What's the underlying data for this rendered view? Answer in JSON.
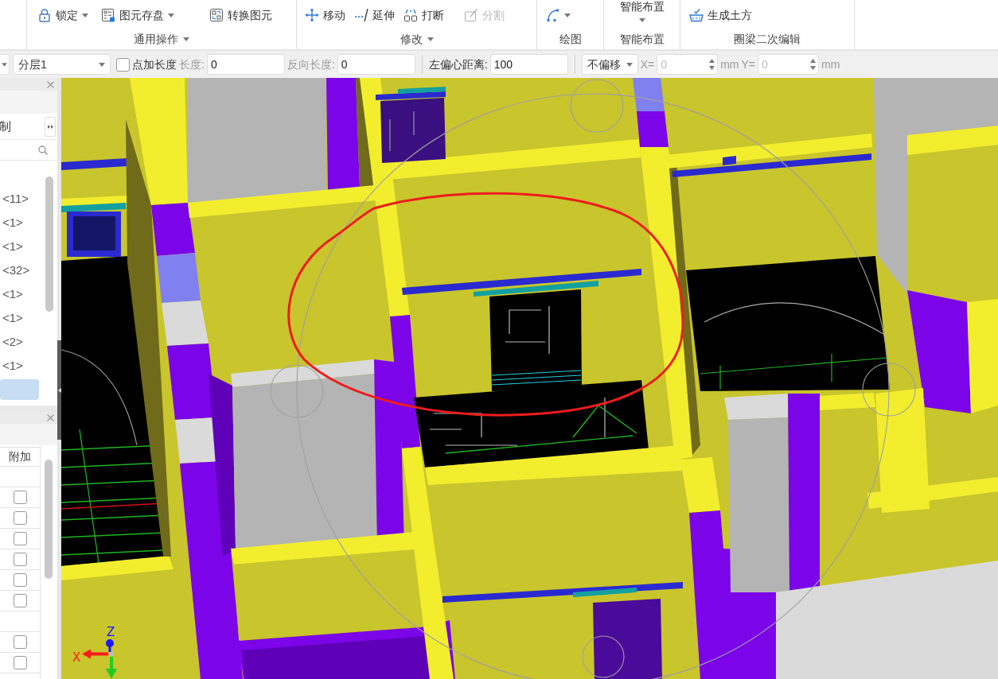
{
  "ribbon": {
    "groups": [
      {
        "label": "通用操作",
        "menu": true,
        "buttons": [
          {
            "label": "锁定",
            "kind": "small",
            "dropdown": true,
            "disabled": false
          },
          {
            "label": "图元存盘",
            "kind": "small",
            "dropdown": true,
            "disabled": false
          },
          {
            "label": "转换图元",
            "kind": "small",
            "dropdown": false,
            "disabled": false
          }
        ]
      },
      {
        "label": "修改",
        "menu": true,
        "buttons": [
          {
            "label": "移动",
            "kind": "small",
            "dropdown": false,
            "disabled": false
          },
          {
            "label": "延伸",
            "kind": "small",
            "dropdown": false,
            "disabled": false
          },
          {
            "label": "打断",
            "kind": "small",
            "dropdown": false,
            "disabled": false
          },
          {
            "label": "分割",
            "kind": "small",
            "dropdown": false,
            "disabled": true
          }
        ]
      },
      {
        "label": "绘图",
        "menu": false,
        "buttons": [
          {
            "kind": "small",
            "dropdown": true,
            "disabled": false
          }
        ]
      },
      {
        "label": "智能布置",
        "menu": false,
        "buttons": [
          {
            "label": "智能布置",
            "kind": "large",
            "dropdown": true,
            "disabled": false
          }
        ]
      },
      {
        "label": "圈梁二次编辑",
        "menu": false,
        "buttons": [
          {
            "label": "生成土方",
            "kind": "small",
            "dropdown": false,
            "disabled": false
          }
        ]
      }
    ]
  },
  "options_bar": {
    "items": [
      {
        "kind": "dropdown"
      },
      {
        "kind": "dropdown",
        "value": "分层1"
      },
      {
        "kind": "checkbox",
        "label": "点加长度",
        "checked": false
      },
      {
        "kind": "label",
        "text": "长度:",
        "disabled": true
      },
      {
        "kind": "input",
        "value": "0",
        "disabled": false
      },
      {
        "kind": "label",
        "text": "反向长度:",
        "disabled": true
      },
      {
        "kind": "input",
        "value": "0",
        "disabled": false
      },
      {
        "kind": "separator"
      },
      {
        "kind": "label",
        "text": "左偏心距离:",
        "disabled": false
      },
      {
        "kind": "input",
        "value": "100",
        "disabled": false
      },
      {
        "kind": "separator"
      },
      {
        "kind": "dropdown",
        "value": "不偏移"
      },
      {
        "kind": "label",
        "text": "X=",
        "disabled": true
      },
      {
        "kind": "spin",
        "value": "0",
        "disabled": true
      },
      {
        "kind": "label",
        "text": "mm",
        "disabled": true
      },
      {
        "kind": "label",
        "text": "Y=",
        "disabled": true
      },
      {
        "kind": "spin",
        "value": "0",
        "disabled": true
      },
      {
        "kind": "label",
        "text": "mm",
        "disabled": true
      }
    ]
  },
  "element_panel": {
    "title": "制",
    "items": [
      {
        "label": "<11>",
        "selected": false
      },
      {
        "label": "<1>",
        "selected": false
      },
      {
        "label": "<1>",
        "selected": false
      },
      {
        "label": "<32>",
        "selected": false
      },
      {
        "label": "<1>",
        "selected": false
      },
      {
        "label": "<1>",
        "selected": false
      },
      {
        "label": "<2>",
        "selected": false
      },
      {
        "label": "<1>",
        "selected": false
      },
      {
        "selected": true
      }
    ]
  },
  "property_panel": {
    "columns": [
      "附加"
    ],
    "rows": [
      {
        "kind": "blank"
      },
      {
        "kind": "checkbox",
        "checked": false
      },
      {
        "kind": "checkbox",
        "checked": false
      },
      {
        "kind": "checkbox",
        "checked": false
      },
      {
        "kind": "checkbox",
        "checked": false
      },
      {
        "kind": "checkbox",
        "checked": false
      },
      {
        "kind": "checkbox",
        "checked": false
      },
      {
        "kind": "blank"
      },
      {
        "kind": "checkbox",
        "checked": false
      },
      {
        "kind": "checkbox",
        "checked": false
      }
    ]
  },
  "viewport": {
    "axes": [
      {
        "label": "Z",
        "color": "#1a1aff"
      },
      {
        "label": "X",
        "color": "#ff1a1a"
      },
      {
        "color": "#22cc22"
      }
    ]
  }
}
